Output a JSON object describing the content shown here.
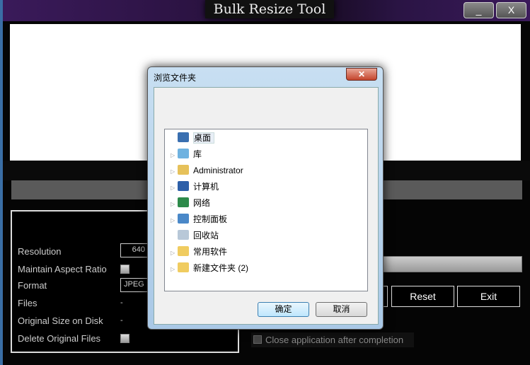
{
  "app": {
    "title": "Bulk Resize Tool",
    "minimize": "_",
    "close": "X"
  },
  "settings": {
    "resolution_label": "Resolution",
    "resolution_value": "640",
    "aspect_label": "Maintain Aspect Ratio",
    "aspect_checked": false,
    "format_label": "Format",
    "format_value": "JPEG",
    "files_label": "Files",
    "files_value": "-",
    "size_label": "Original Size on Disk",
    "size_value": "-",
    "delete_label": "Delete Original Files",
    "delete_checked": false
  },
  "actions": {
    "reset": "Reset",
    "exit": "Exit",
    "close_after": "Close application after completion"
  },
  "dialog": {
    "title": "浏览文件夹",
    "close": "✕",
    "items": [
      {
        "label": "桌面",
        "icon": "desktop-icon",
        "expandable": false,
        "selected": true
      },
      {
        "label": "库",
        "icon": "library-icon",
        "expandable": true
      },
      {
        "label": "Administrator",
        "icon": "user-folder-icon",
        "expandable": true
      },
      {
        "label": "计算机",
        "icon": "computer-icon",
        "expandable": true
      },
      {
        "label": "网络",
        "icon": "network-icon",
        "expandable": true
      },
      {
        "label": "控制面板",
        "icon": "control-panel-icon",
        "expandable": true
      },
      {
        "label": "回收站",
        "icon": "recycle-bin-icon",
        "expandable": false
      },
      {
        "label": "常用软件",
        "icon": "folder-icon",
        "expandable": true
      },
      {
        "label": "新建文件夹 (2)",
        "icon": "folder-icon",
        "expandable": true
      }
    ],
    "ok": "确定",
    "cancel": "取消"
  }
}
